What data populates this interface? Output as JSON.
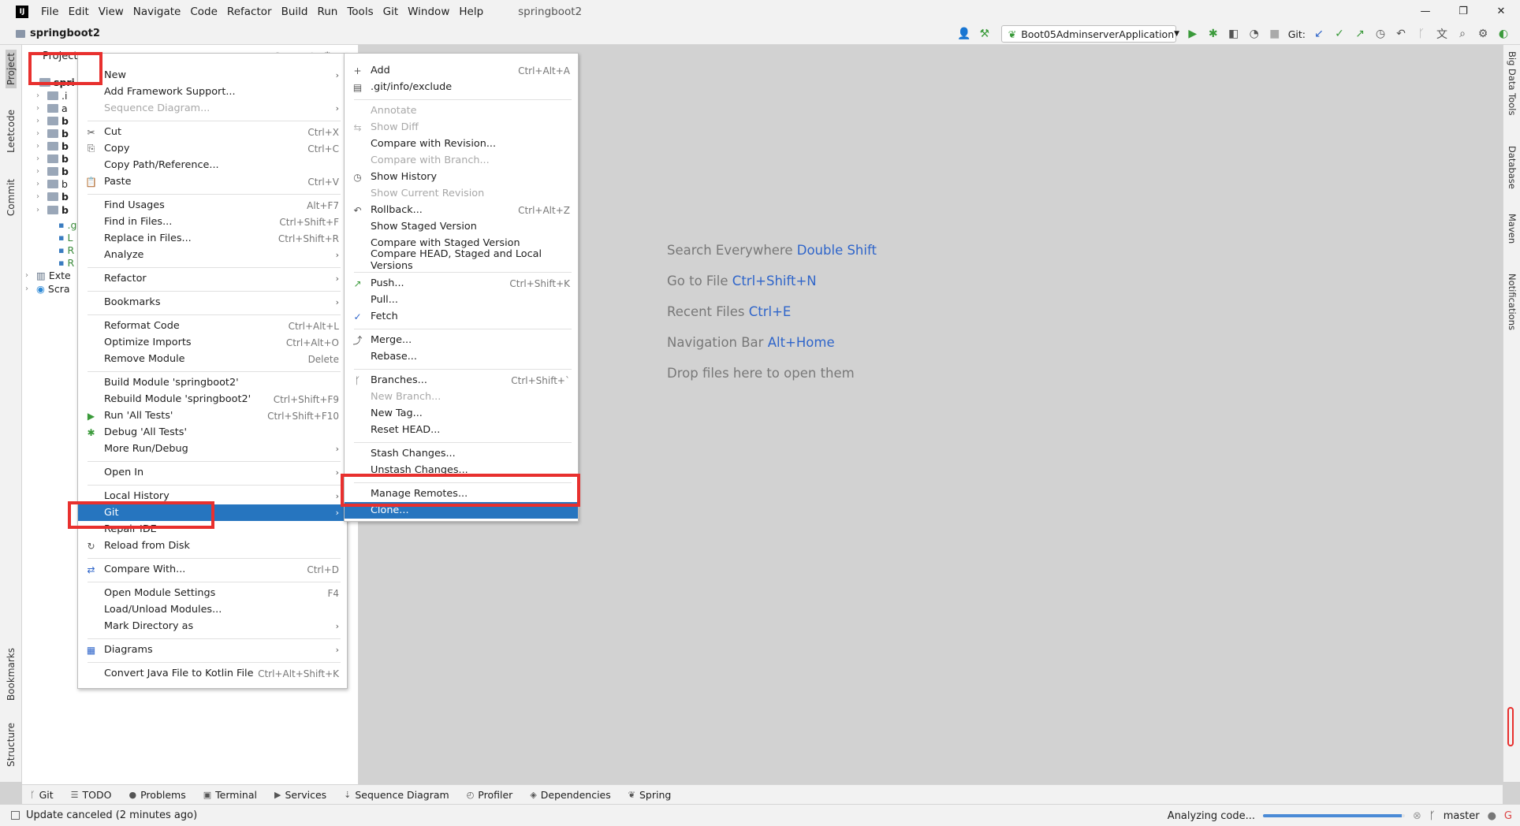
{
  "window": {
    "title": "springboot2",
    "menu": [
      "File",
      "Edit",
      "View",
      "Navigate",
      "Code",
      "Refactor",
      "Build",
      "Run",
      "Tools",
      "Git",
      "Window",
      "Help"
    ],
    "controls": [
      "—",
      "❐",
      "✕"
    ]
  },
  "navbar": {
    "project": "springboot2",
    "run_config": "Boot05AdminserverApplication",
    "git_label": "Git:"
  },
  "left_stripe": [
    "Project",
    "Leetcode",
    "Commit",
    "Bookmarks",
    "Structure"
  ],
  "right_stripe": [
    "Big Data Tools",
    "Database",
    "Maven",
    "Notifications"
  ],
  "project_panel": {
    "title": "Project",
    "tree": [
      {
        "label": "spri",
        "bold": true
      },
      {
        "label": ".i"
      },
      {
        "label": "a"
      },
      {
        "label": "b",
        "bold": true
      },
      {
        "label": "b",
        "bold": true
      },
      {
        "label": "b",
        "bold": true
      },
      {
        "label": "b",
        "bold": true
      },
      {
        "label": "b",
        "bold": true
      },
      {
        "label": "b"
      },
      {
        "label": "b",
        "bold": true
      },
      {
        "label": "b",
        "bold": true
      },
      {
        "label": ".g"
      },
      {
        "label": "L"
      },
      {
        "label": "R"
      },
      {
        "label": "R"
      },
      {
        "label": "Exte"
      },
      {
        "label": "Scra"
      }
    ]
  },
  "editor_hints": [
    {
      "text": "Search Everywhere",
      "key": "Double Shift"
    },
    {
      "text": "Go to File",
      "key": "Ctrl+Shift+N"
    },
    {
      "text": "Recent Files",
      "key": "Ctrl+E"
    },
    {
      "text": "Navigation Bar",
      "key": "Alt+Home"
    },
    {
      "text": "Drop files here to open them",
      "key": ""
    }
  ],
  "context_menu": [
    {
      "label": "New",
      "submenu": true
    },
    {
      "label": "Add Framework Support..."
    },
    {
      "label": "Sequence Diagram...",
      "disabled": true,
      "submenu": true
    },
    {
      "sep": true
    },
    {
      "label": "Cut",
      "shortcut": "Ctrl+X",
      "icon": "✂"
    },
    {
      "label": "Copy",
      "shortcut": "Ctrl+C",
      "icon": "⎘"
    },
    {
      "label": "Copy Path/Reference..."
    },
    {
      "label": "Paste",
      "shortcut": "Ctrl+V",
      "icon": "📋"
    },
    {
      "sep": true
    },
    {
      "label": "Find Usages",
      "shortcut": "Alt+F7"
    },
    {
      "label": "Find in Files...",
      "shortcut": "Ctrl+Shift+F"
    },
    {
      "label": "Replace in Files...",
      "shortcut": "Ctrl+Shift+R"
    },
    {
      "label": "Analyze",
      "submenu": true
    },
    {
      "sep": true
    },
    {
      "label": "Refactor",
      "submenu": true
    },
    {
      "sep": true
    },
    {
      "label": "Bookmarks",
      "submenu": true
    },
    {
      "sep": true
    },
    {
      "label": "Reformat Code",
      "shortcut": "Ctrl+Alt+L"
    },
    {
      "label": "Optimize Imports",
      "shortcut": "Ctrl+Alt+O"
    },
    {
      "label": "Remove Module",
      "shortcut": "Delete"
    },
    {
      "sep": true
    },
    {
      "label": "Build Module 'springboot2'"
    },
    {
      "label": "Rebuild Module 'springboot2'",
      "shortcut": "Ctrl+Shift+F9"
    },
    {
      "label": "Run 'All Tests'",
      "shortcut": "Ctrl+Shift+F10",
      "icon": "▶",
      "icon_color": "#3a9a3a"
    },
    {
      "label": "Debug 'All Tests'",
      "icon": "✱",
      "icon_color": "#3a9a3a"
    },
    {
      "label": "More Run/Debug",
      "submenu": true
    },
    {
      "sep": true
    },
    {
      "label": "Open In",
      "submenu": true
    },
    {
      "sep": true
    },
    {
      "label": "Local History",
      "submenu": true
    },
    {
      "label": "Git",
      "submenu": true,
      "selected": true
    },
    {
      "label": "Repair IDE"
    },
    {
      "label": "Reload from Disk",
      "icon": "↻"
    },
    {
      "sep": true
    },
    {
      "label": "Compare With...",
      "shortcut": "Ctrl+D",
      "icon": "⇄",
      "icon_color": "#2f65ca"
    },
    {
      "sep": true
    },
    {
      "label": "Open Module Settings",
      "shortcut": "F4"
    },
    {
      "label": "Load/Unload Modules..."
    },
    {
      "label": "Mark Directory as",
      "submenu": true
    },
    {
      "sep": true
    },
    {
      "label": "Diagrams",
      "submenu": true,
      "icon": "▦",
      "icon_color": "#2f65ca"
    },
    {
      "sep": true
    },
    {
      "label": "Convert Java File to Kotlin File",
      "shortcut": "Ctrl+Alt+Shift+K"
    }
  ],
  "git_submenu": [
    {
      "label": "Add",
      "shortcut": "Ctrl+Alt+A",
      "icon": "+"
    },
    {
      "label": ".git/info/exclude",
      "icon": "▤"
    },
    {
      "sep": true
    },
    {
      "label": "Annotate",
      "disabled": true
    },
    {
      "label": "Show Diff",
      "disabled": true,
      "icon": "⇆"
    },
    {
      "label": "Compare with Revision..."
    },
    {
      "label": "Compare with Branch...",
      "disabled": true
    },
    {
      "label": "Show History",
      "icon": "◷"
    },
    {
      "label": "Show Current Revision",
      "disabled": true
    },
    {
      "label": "Rollback...",
      "shortcut": "Ctrl+Alt+Z",
      "icon": "↶"
    },
    {
      "label": "Show Staged Version"
    },
    {
      "label": "Compare with Staged Version"
    },
    {
      "label": "Compare HEAD, Staged and Local Versions"
    },
    {
      "sep": true
    },
    {
      "label": "Push...",
      "shortcut": "Ctrl+Shift+K",
      "icon": "↗",
      "icon_color": "#3a9a3a"
    },
    {
      "label": "Pull..."
    },
    {
      "label": "Fetch",
      "icon": "✓",
      "icon_color": "#2f65ca"
    },
    {
      "sep": true
    },
    {
      "label": "Merge...",
      "icon": "⤴"
    },
    {
      "label": "Rebase..."
    },
    {
      "sep": true
    },
    {
      "label": "Branches...",
      "shortcut": "Ctrl+Shift+`",
      "icon": "ᚴ"
    },
    {
      "label": "New Branch...",
      "disabled": true
    },
    {
      "label": "New Tag..."
    },
    {
      "label": "Reset HEAD..."
    },
    {
      "sep": true
    },
    {
      "label": "Stash Changes..."
    },
    {
      "label": "Unstash Changes..."
    },
    {
      "sep": true
    },
    {
      "label": "Manage Remotes..."
    },
    {
      "label": "Clone...",
      "selected": true
    }
  ],
  "bottom_tabs": [
    {
      "icon": "ᚴ",
      "label": "Git"
    },
    {
      "icon": "☰",
      "label": "TODO"
    },
    {
      "icon": "●",
      "label": "Problems"
    },
    {
      "icon": "▣",
      "label": "Terminal"
    },
    {
      "icon": "▶",
      "label": "Services"
    },
    {
      "icon": "⇣",
      "label": "Sequence Diagram"
    },
    {
      "icon": "◴",
      "label": "Profiler"
    },
    {
      "icon": "◈",
      "label": "Dependencies"
    },
    {
      "icon": "❦",
      "label": "Spring"
    }
  ],
  "status": {
    "message": "Update canceled (2 minutes ago)",
    "analyzing": "Analyzing code...",
    "progress": 0.98,
    "branch": "master"
  },
  "colors": {
    "selection": "#2675bf",
    "highlight_box": "#e8302e",
    "hint_key": "#2f65ca"
  }
}
